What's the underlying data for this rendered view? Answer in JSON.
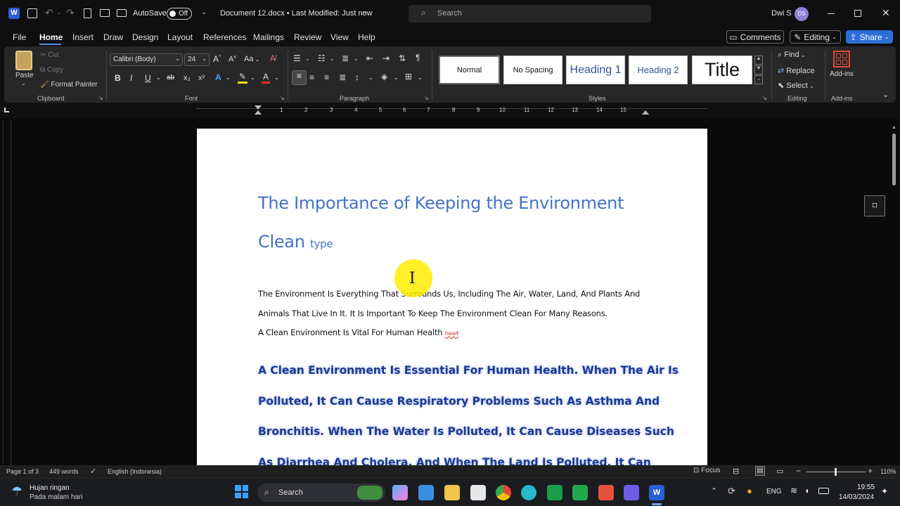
{
  "titlebar": {
    "autosave_label": "AutoSave",
    "toggle_state": "Off",
    "doc_title": "Document 12.docx • Last Modified: Just now",
    "search_placeholder": "Search",
    "user_name": "Dwi S",
    "user_initials": "DS"
  },
  "menu": {
    "items": [
      "File",
      "Home",
      "Insert",
      "Draw",
      "Design",
      "Layout",
      "References",
      "Mailings",
      "Review",
      "View",
      "Help"
    ],
    "active": "Home",
    "comments": "Comments",
    "editing": "Editing",
    "share": "Share"
  },
  "ribbon": {
    "clipboard": {
      "paste": "Paste",
      "cut": "Cut",
      "copy": "Copy",
      "format_painter": "Format Painter",
      "group": "Clipboard"
    },
    "font": {
      "family": "Calibri (Body)",
      "size": "24",
      "group": "Font",
      "bold": "B",
      "italic": "I",
      "underline": "U",
      "strike": "ab",
      "sub": "x₂",
      "sup": "x²",
      "aa": "Aa"
    },
    "paragraph": {
      "group": "Paragraph"
    },
    "styles": {
      "items": [
        "Normal",
        "No Spacing",
        "Heading 1",
        "Heading 2",
        "Title"
      ],
      "group": "Styles"
    },
    "editing": {
      "find": "Find",
      "replace": "Replace",
      "select": "Select",
      "group": "Editing"
    },
    "addins": {
      "label": "Add-ins",
      "group": "Add-ins"
    }
  },
  "ruler": {
    "numbers": [
      "1",
      "2",
      "3",
      "4",
      "5",
      "6",
      "7",
      "8",
      "9",
      "10",
      "11",
      "12",
      "13",
      "14",
      "15"
    ]
  },
  "document": {
    "title_line1": "The Importance of Keeping the Environment",
    "title_line2": "Clean",
    "title_suffix": "type",
    "para1_line1": "The Environment Is Everything That Surrounds Us, Including The Air, Water, Land, And Plants And",
    "para1_line2": "Animals That Live In It. It Is Important To Keep The Environment Clean For Many Reasons.",
    "para1_line3": "A Clean Environment Is Vital For Human Health",
    "para1_suffix": "healt",
    "big_lines": [
      "A Clean Environment Is Essential For Human Health. When The Air Is",
      "Polluted, It Can Cause Respiratory Problems Such As Asthma And",
      "Bronchitis. When The Water Is Polluted, It Can Cause Diseases Such",
      "As Diarrhea And Cholera. And When The Land Is Polluted, It Can"
    ]
  },
  "status": {
    "page": "Page 1 of 3",
    "words": "449 words",
    "language": "English (Indonesia)",
    "focus": "Focus",
    "zoom": "110%"
  },
  "taskbar": {
    "weather_title": "Hujan ringan",
    "weather_sub": "Pada malam hari",
    "search": "Search",
    "lang": "ENG",
    "time": "19:55",
    "date": "14/03/2024"
  },
  "colors": {
    "accent": "#4472c4",
    "share": "#2b6fd6",
    "heading_blue": "#1f3a93",
    "cursor_highlight": "#ffee00"
  }
}
